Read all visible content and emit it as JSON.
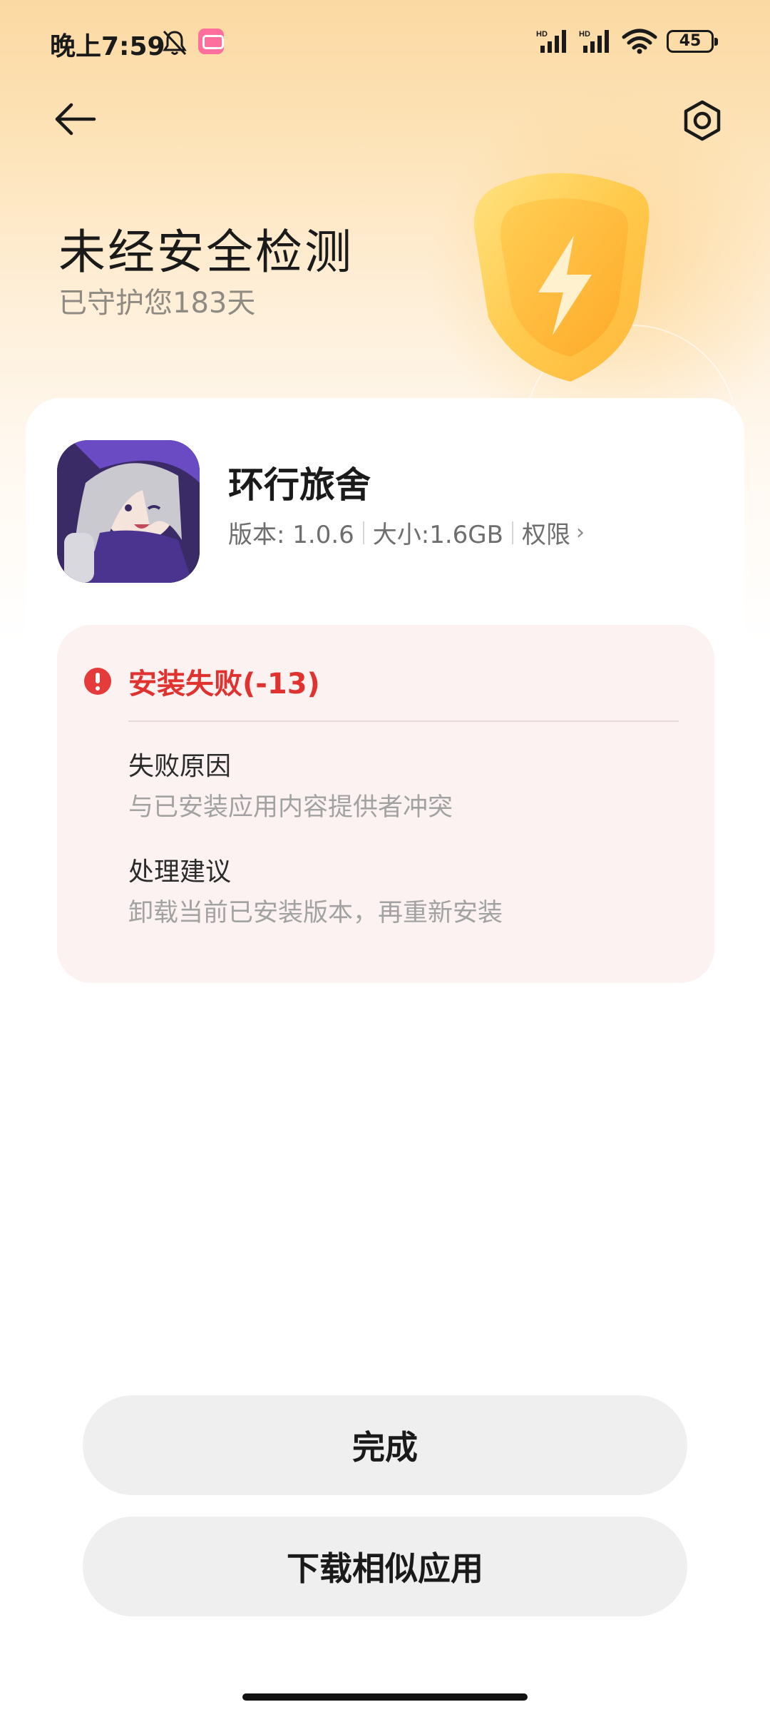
{
  "status_bar": {
    "time": "晚上7:59",
    "battery": "45",
    "icons": [
      "bell-off-icon",
      "bilibili-icon",
      "hd-signal-icon",
      "hd-signal-icon",
      "wifi-icon",
      "battery-icon"
    ]
  },
  "header": {
    "back_icon": "arrow-left-icon",
    "settings_icon": "gear-icon"
  },
  "hero": {
    "title": "未经安全检测",
    "subtitle": "已守护您183天",
    "badge_icon": "shield-lightning-icon"
  },
  "app": {
    "name": "环行旅舍",
    "version": "版本: 1.0.6",
    "size": "大小:1.6GB",
    "permissions": "权限",
    "permissions_chevron": "›"
  },
  "error": {
    "title": "安装失败(-13)",
    "reason_label": "失败原因",
    "reason_text": "与已安装应用内容提供者冲突",
    "advice_label": "处理建议",
    "advice_text": "卸载当前已安装版本，再重新安装"
  },
  "actions": {
    "done": "完成",
    "download_similar": "下载相似应用"
  },
  "colors": {
    "accent_error": "#e0322f",
    "panel_bg": "#fdf2f2",
    "button_bg": "#efefef"
  }
}
